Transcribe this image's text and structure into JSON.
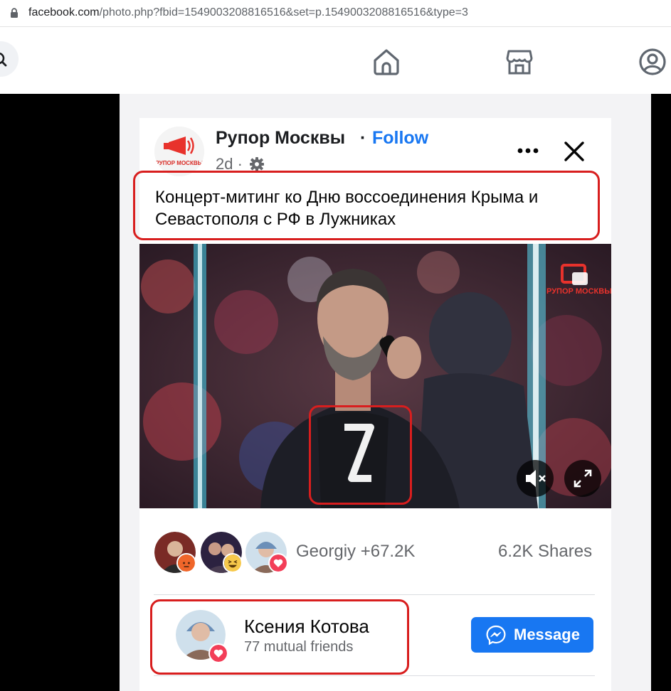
{
  "browser": {
    "url_host": "facebook.com",
    "url_rest": "/photo.php?fbid=1549003208816516&set=p.1549003208816516&type=3"
  },
  "nav": {
    "icons": [
      "search-icon",
      "home-icon",
      "marketplace-icon",
      "profile-circle-icon"
    ]
  },
  "post": {
    "page_name": "Рупор Москвы",
    "separator": "·",
    "follow_label": "Follow",
    "time": "2d ·",
    "text": "Концерт-митинг ко Дню воссоединения Крыма и Севастополя с РФ в Лужниках",
    "avatar_logo_text": "РУПОР МОСКВЫ",
    "video_watermark": "РУПОР МОСКВЫ"
  },
  "reactions": {
    "summary": "Georgiy +67.2K",
    "shares": "6.2K Shares",
    "emoji": [
      "angry",
      "haha",
      "love"
    ]
  },
  "friend": {
    "name": "Ксения Котова",
    "mutual": "77 mutual friends",
    "message_label": "Message"
  },
  "colors": {
    "accent": "#1877f2",
    "annotation": "#d81e1e",
    "secondary_text": "#65676b"
  }
}
